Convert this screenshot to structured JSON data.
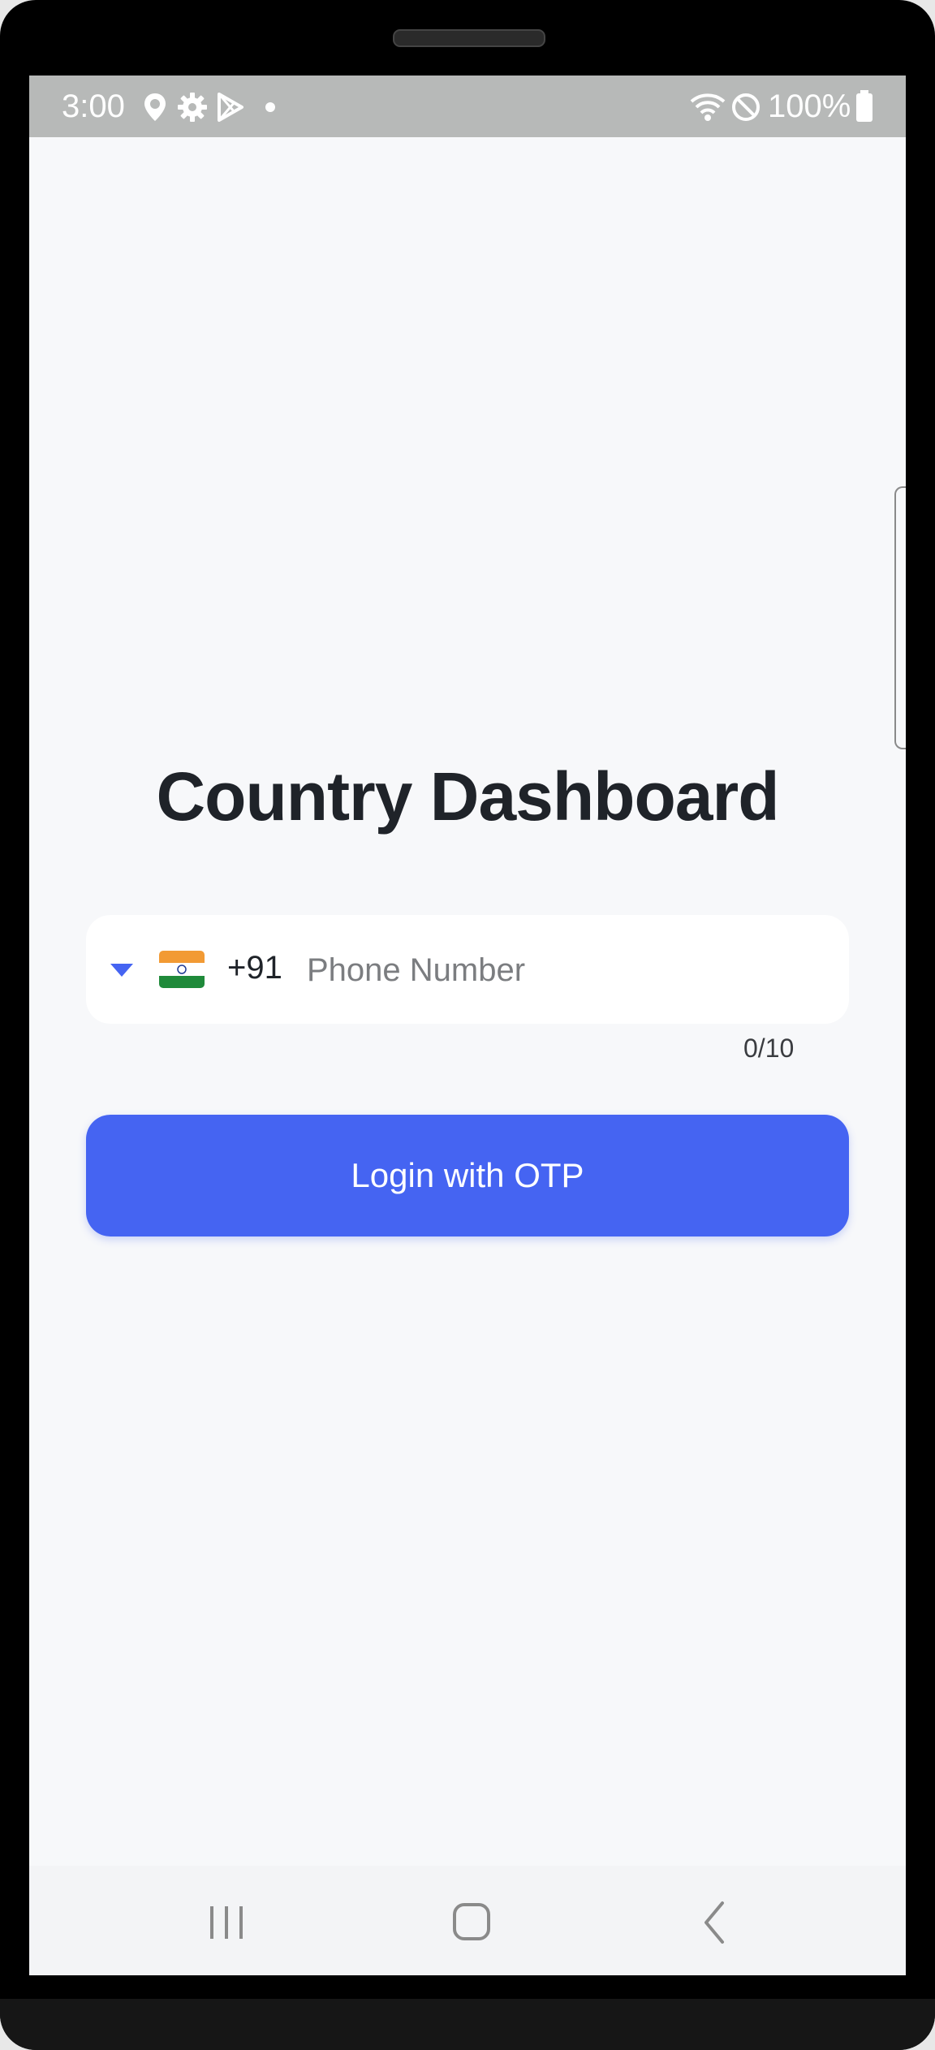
{
  "status_bar": {
    "time": "3:00",
    "battery": "100%",
    "icons": [
      "location-icon",
      "settings-icon",
      "play-store-icon",
      "dot-icon",
      "wifi-icon",
      "do-not-disturb-icon",
      "battery-icon"
    ]
  },
  "login": {
    "title": "Country Dashboard",
    "country_flag": "india-flag-icon",
    "dial_code": "+91",
    "phone_placeholder": "Phone Number",
    "phone_value": "",
    "char_counter": "0/10",
    "button_label": "Login with OTP"
  },
  "nav_bar": {
    "buttons": [
      "recents",
      "home",
      "back"
    ]
  },
  "colors": {
    "accent": "#4564f2",
    "background": "#f7f8fa",
    "status_bar": "#b7b9b8",
    "title": "#1f2329"
  }
}
